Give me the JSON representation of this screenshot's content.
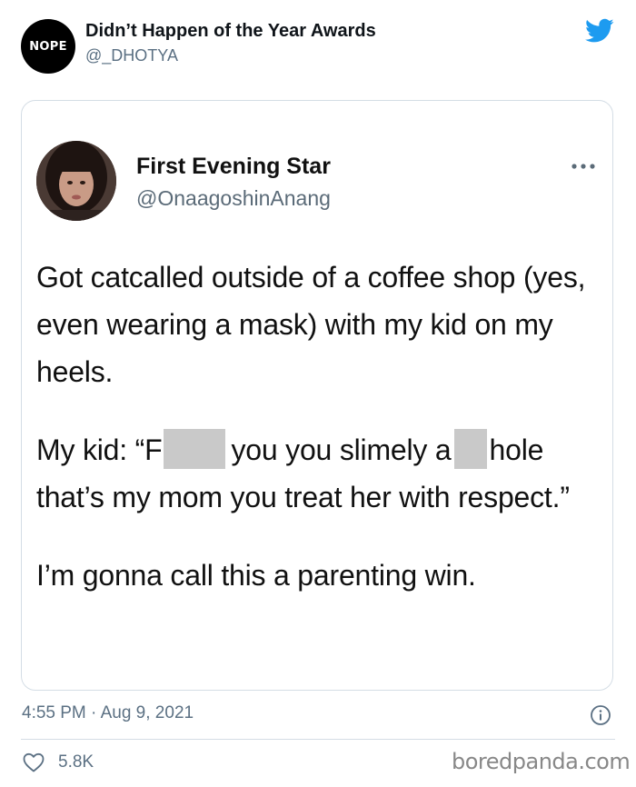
{
  "outer_tweet": {
    "avatar_text": "NOPE",
    "display_name": "Didn’t Happen of the Year Awards",
    "handle": "@_DHOTYA",
    "brand_icon": "twitter-bird-icon",
    "timestamp": "4:55 PM · Aug 9, 2021",
    "likes": "5.8K"
  },
  "quoted_tweet": {
    "display_name": "First Evening Star",
    "handle": "@OnaagoshinAnang",
    "paragraph_1": "Got catcalled outside of a coffee shop (yes, even wearing a mask) with my kid on my heels.",
    "paragraph_2": {
      "part_1": "My kid: “F",
      "part_2": "you you slimely a",
      "part_3": "hole that’s my mom you treat her with respect.”"
    },
    "paragraph_3": "I’m gonna call this a parenting win."
  },
  "watermark": "boredpanda.com",
  "colors": {
    "twitter_blue": "#1d9bf0",
    "secondary_text": "#5b7083",
    "border": "#d4dde5",
    "redaction": "#c9c9c9"
  }
}
